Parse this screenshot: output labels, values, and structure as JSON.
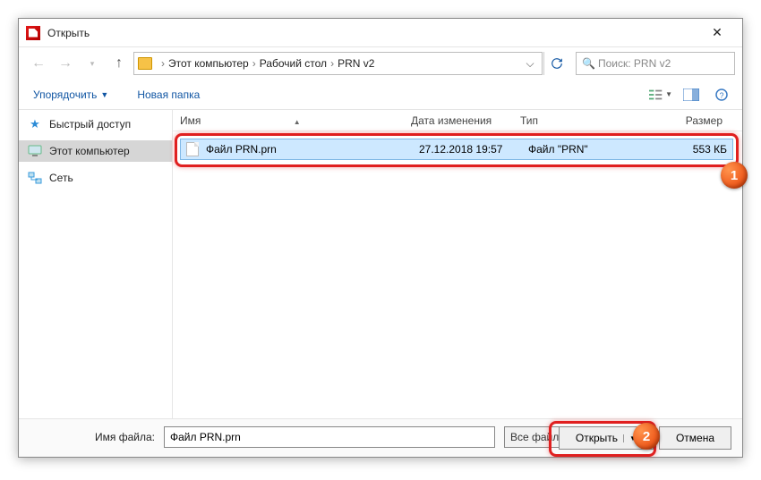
{
  "window": {
    "title": "Открыть"
  },
  "breadcrumb": {
    "parts": [
      "Этот компьютер",
      "Рабочий стол",
      "PRN v2"
    ]
  },
  "search": {
    "placeholder": "Поиск: PRN v2"
  },
  "toolbar": {
    "organize": "Упорядочить",
    "newfolder": "Новая папка"
  },
  "sidebar": {
    "items": [
      {
        "label": "Быстрый доступ"
      },
      {
        "label": "Этот компьютер"
      },
      {
        "label": "Сеть"
      }
    ]
  },
  "columns": {
    "name": "Имя",
    "date": "Дата изменения",
    "type": "Тип",
    "size": "Размер"
  },
  "files": {
    "row0": {
      "name": "Файл PRN.prn",
      "date": "27.12.2018 19:57",
      "type": "Файл \"PRN\"",
      "size": "553 КБ"
    }
  },
  "footer": {
    "label": "Имя файла:",
    "value": "Файл PRN.prn",
    "filter": "Все файлы (*.*)",
    "open": "Открыть",
    "cancel": "Отмена"
  },
  "annotations": {
    "b1": "1",
    "b2": "2"
  }
}
